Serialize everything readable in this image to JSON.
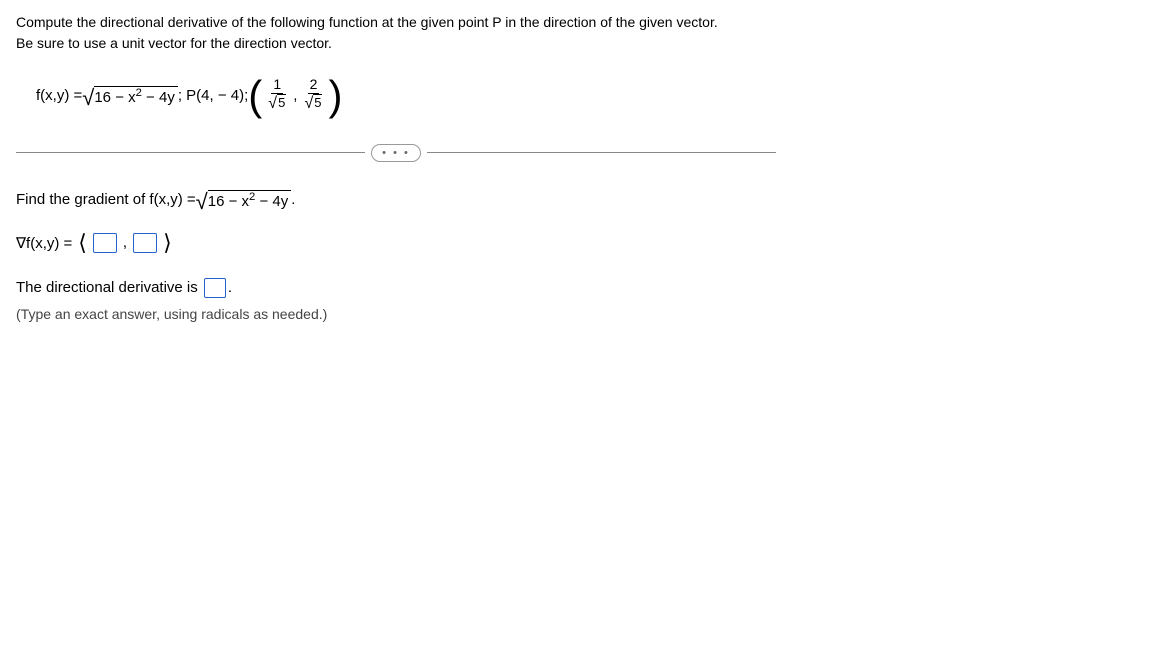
{
  "instructions": {
    "line1": "Compute the directional derivative of the following function at the given point P in the direction of the given vector.",
    "line2": "Be sure to use a unit vector for the direction vector."
  },
  "formula": {
    "func_lhs": "f(x,y) = ",
    "radicand": "16 − x",
    "radicand_exp": "2",
    "radicand_tail": " − 4y",
    "point_prefix": " ; P(4, − 4); ",
    "vec_num1": "1",
    "vec_den1": "5",
    "vec_sep": ",",
    "vec_num2": "2",
    "vec_den2": "5"
  },
  "divider_pill": "• • •",
  "gradient_prompt": {
    "pre": "Find the gradient of f(x,y) = ",
    "radicand": "16 − x",
    "radicand_exp": "2",
    "radicand_tail": " − 4y",
    "post": " ."
  },
  "gradient_eq": {
    "lhs": "∇f(x,y) = ",
    "open": "⟨",
    "comma": ",",
    "close": "⟩"
  },
  "deriv": {
    "pre": "The directional derivative is ",
    "post": "."
  },
  "hint": "(Type an exact answer, using radicals as needed.)"
}
